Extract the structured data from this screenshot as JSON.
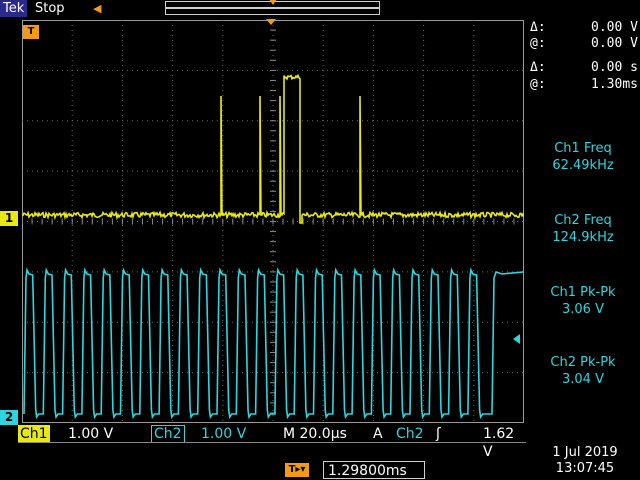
{
  "topbar": {
    "brand": "Tek",
    "run_state": "Stop"
  },
  "markers": {
    "ch1": "1",
    "ch2": "2",
    "trigger_top": "T",
    "position_icon": "T▸▾"
  },
  "cursors": [
    {
      "sym": "Δ:",
      "val": "0.00 V"
    },
    {
      "sym": "@:",
      "val": "0.00 V"
    },
    {
      "sym": "Δ:",
      "val": "0.00 s"
    },
    {
      "sym": "@:",
      "val": "1.30ms"
    }
  ],
  "measurements": [
    {
      "label": "Ch1 Freq",
      "value": "62.49kHz"
    },
    {
      "label": "Ch2 Freq",
      "value": "124.9kHz"
    },
    {
      "label": "Ch1 Pk-Pk",
      "value": "3.06 V"
    },
    {
      "label": "Ch2 Pk-Pk",
      "value": "3.04 V"
    }
  ],
  "status": {
    "ch1_tag": "Ch1",
    "ch1_scale": "1.00 V",
    "ch2_tag": "Ch2",
    "ch2_scale": "1.00 V",
    "timebase": "M 20.0µs",
    "trigger_mode": "A",
    "trigger_source": "Ch2",
    "trigger_slope": "ʃ",
    "trigger_level": "1.62 V"
  },
  "position": "1.29800ms",
  "date": "1 Jul  2019",
  "time": "13:07:45",
  "colors": {
    "ch1": "#e8e815",
    "ch2": "#2ed6e0",
    "trigger": "#f39c12",
    "brand_bg": "#2a2a8c"
  }
}
